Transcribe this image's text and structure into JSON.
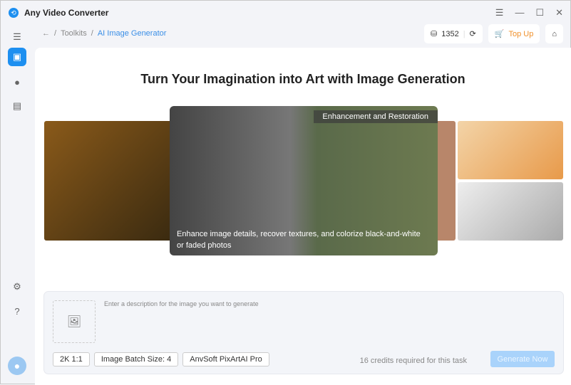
{
  "app": {
    "title": "Any Video Converter"
  },
  "breadcrumb": {
    "level1": "Toolkits",
    "current": "AI Image Generator"
  },
  "header": {
    "credits": "1352",
    "topup_label": "Top Up"
  },
  "main": {
    "headline": "Turn Your Imagination into Art with Image Generation",
    "carousel": {
      "tag": "Enhancement and Restoration",
      "description": "Enhance image details, recover textures, and colorize black-and-white or faded photos"
    }
  },
  "panel": {
    "placeholder": "Enter a description for the image you want to generate",
    "chips": [
      "2K 1:1",
      "Image Batch Size: 4",
      "AnvSoft PixArtAI Pro"
    ],
    "credits_text": "16 credits required for this task",
    "generate_label": "Generate Now"
  },
  "colors": {
    "accent": "#1d8ff0",
    "topup": "#f0902a"
  }
}
